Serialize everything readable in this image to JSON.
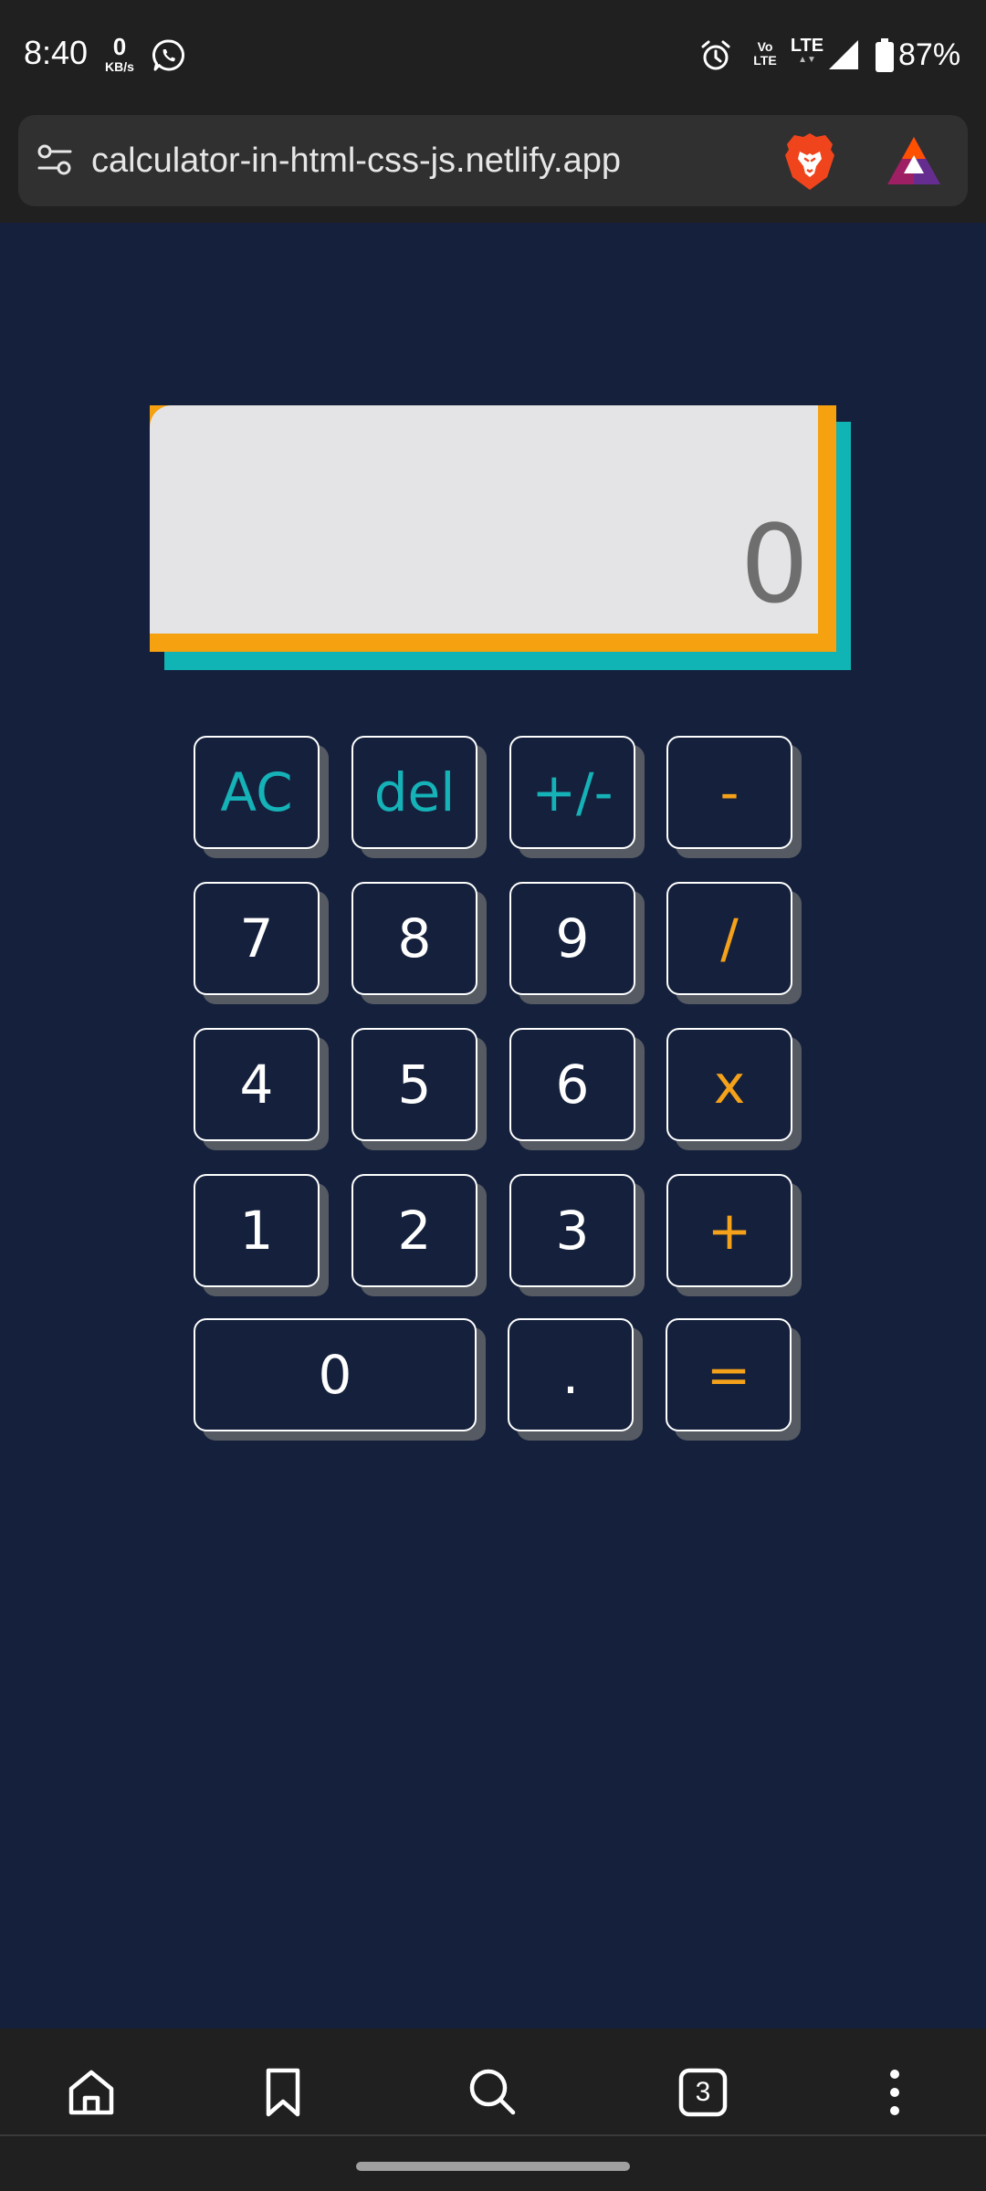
{
  "status_bar": {
    "time": "8:40",
    "net_speed_value": "0",
    "net_speed_unit": "KB/s",
    "volte_line1": "Vo",
    "volte_line2": "LTE",
    "lte": "LTE",
    "battery": "87%",
    "icons": [
      "whatsapp-icon",
      "alarm-icon",
      "signal-icon",
      "battery-icon"
    ]
  },
  "browser": {
    "url": "calculator-in-html-css-js.netlify.app",
    "icons": [
      "tune-icon",
      "brave-shield-icon",
      "bat-rewards-icon"
    ]
  },
  "calculator": {
    "display": "0",
    "keys": [
      {
        "label": "AC",
        "role": "function"
      },
      {
        "label": "del",
        "role": "function"
      },
      {
        "label": "+/-",
        "role": "function"
      },
      {
        "label": "-",
        "role": "operator"
      },
      {
        "label": "7",
        "role": "digit"
      },
      {
        "label": "8",
        "role": "digit"
      },
      {
        "label": "9",
        "role": "digit"
      },
      {
        "label": "/",
        "role": "operator"
      },
      {
        "label": "4",
        "role": "digit"
      },
      {
        "label": "5",
        "role": "digit"
      },
      {
        "label": "6",
        "role": "digit"
      },
      {
        "label": "x",
        "role": "operator"
      },
      {
        "label": "1",
        "role": "digit"
      },
      {
        "label": "2",
        "role": "digit"
      },
      {
        "label": "3",
        "role": "digit"
      },
      {
        "label": "+",
        "role": "operator"
      },
      {
        "label": "0",
        "role": "digit"
      },
      {
        "label": ".",
        "role": "digit"
      },
      {
        "label": "=",
        "role": "operator"
      }
    ]
  },
  "bottom_nav": {
    "tabs_count": "3",
    "icons": [
      "home-icon",
      "bookmark-icon",
      "search-icon",
      "tabs-icon",
      "more-icon"
    ]
  },
  "colors": {
    "page_background": "#15213c",
    "accent_teal": "#15b2b8",
    "accent_orange": "#f5a21a",
    "display_background": "#e4e4e6",
    "display_text": "#6e6e6e"
  }
}
